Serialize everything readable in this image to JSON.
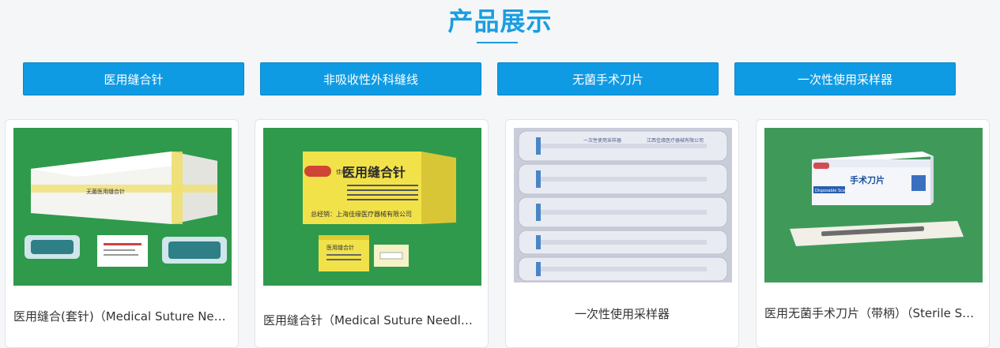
{
  "section": {
    "title": "产品展示"
  },
  "tabs": [
    {
      "label": "医用缝合针"
    },
    {
      "label": "非吸收性外科缝线"
    },
    {
      "label": "无菌手术刀片"
    },
    {
      "label": "一次性使用采样器"
    }
  ],
  "products": [
    {
      "caption": "医用缝合(套针)（Medical Suture Needle）",
      "image_icon": "suture-kit-image",
      "box_label": "无菌医用缝合针"
    },
    {
      "caption": "医用缝合针（Medical Suture Needle）",
      "image_icon": "suture-box-image",
      "box_label": "医用缝合针",
      "brand_label": "佳缘",
      "distributor_label": "总经销：上海佳缘医疗器械有限公司",
      "small_box_label": "医用缝合针"
    },
    {
      "caption": "一次性使用采样器",
      "image_icon": "sampler-packs-image",
      "pack_label_left": "一次性使用采样器",
      "pack_label_right": "江西佳缘医疗器械有限公司"
    },
    {
      "caption": "医用无菌手术刀片（带柄）（Sterile Surgical Blade）",
      "image_icon": "scalpel-box-image",
      "box_label": "手术刀片",
      "box_sublabel": "Disposable Scalpel"
    }
  ],
  "colors": {
    "accent": "#1a9ee0",
    "tab_bg": "#0f9be4",
    "green_backdrop": "#2f9a4c"
  }
}
